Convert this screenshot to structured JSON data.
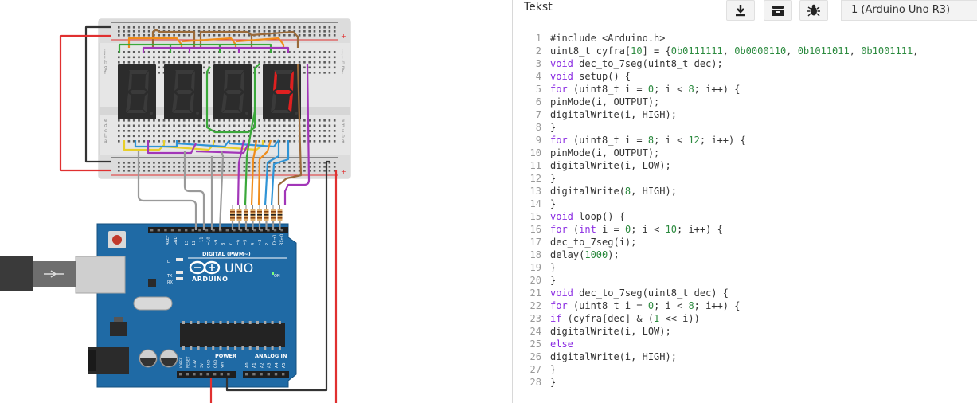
{
  "code_panel": {
    "title": "Tekst",
    "device": "1 (Arduino Uno R3)",
    "toolbar_icons": [
      "download-icon",
      "library-icon",
      "debug-bug-icon"
    ]
  },
  "code_lines": [
    "#include <Arduino.h>",
    "uint8_t cyfra[10] = {0b0111111, 0b0000110, 0b1011011, 0b1001111,",
    "void dec_to_7seg(uint8_t dec);",
    "void setup() {",
    "for (uint8_t i = 0; i < 8; i++) {",
    "pinMode(i, OUTPUT);",
    "digitalWrite(i, HIGH);",
    "}",
    "for (uint8_t i = 8; i < 12; i++) {",
    "pinMode(i, OUTPUT);",
    "digitalWrite(i, LOW);",
    "}",
    "digitalWrite(8, HIGH);",
    "}",
    "void loop() {",
    "for (int i = 0; i < 10; i++) {",
    "dec_to_7seg(i);",
    "delay(1000);",
    "}",
    "}",
    "void dec_to_7seg(uint8_t dec) {",
    "for (uint8_t i = 0; i < 8; i++) {",
    "if (cyfra[dec] & (1 << i))",
    "digitalWrite(i, LOW);",
    "else",
    "digitalWrite(i, HIGH);",
    "}",
    "}"
  ],
  "line_numbers": [
    "1",
    "2",
    "3",
    "4",
    "5",
    "6",
    "7",
    "8",
    "9",
    "10",
    "11",
    "12",
    "13",
    "14",
    "15",
    "16",
    "17",
    "18",
    "19",
    "20",
    "21",
    "22",
    "23",
    "24",
    "25",
    "26",
    "27",
    "28"
  ],
  "board": {
    "brand": "ARDUINO",
    "model": "UNO",
    "digital_label": "DIGITAL (PWM~)",
    "power_label": "POWER",
    "analog_label": "ANALOG IN",
    "on_label": "ON",
    "tx_label": "TX",
    "rx_label": "RX",
    "aref_label": "AREF",
    "gnd_label": "GND",
    "l_label": "L",
    "digital_pins": [
      "13",
      "12",
      "~11",
      "~10",
      "~9",
      "8",
      "7",
      "~6",
      "~5",
      "4",
      "~3",
      "2",
      "TX→1",
      "RX←0"
    ],
    "power_pins": [
      "IOREF",
      "RESET",
      "3.3V",
      "5V",
      "GND",
      "GND",
      "Vin"
    ],
    "analog_pins": [
      "A0",
      "A1",
      "A2",
      "A3",
      "A4",
      "A5"
    ]
  },
  "display": {
    "digit_4_value": "4",
    "lit_color": "#e02020",
    "off_color": "#3a3a3a"
  },
  "breadboard": {
    "rows_top": [
      "j",
      "i",
      "h",
      "g",
      "f"
    ],
    "rows_bottom": [
      "e",
      "d",
      "c",
      "b",
      "a"
    ]
  },
  "colors": {
    "board_blue": "#1f6aa5",
    "wire_red": "#e03030",
    "wire_black": "#333333",
    "wire_orange": "#f08c1a",
    "wire_green": "#3aa83a",
    "wire_purple": "#a236b8",
    "wire_brown": "#9a6a3a",
    "wire_yellow": "#e8cf2a",
    "wire_blue": "#2f94d6",
    "wire_gray": "#9a9a9a"
  }
}
